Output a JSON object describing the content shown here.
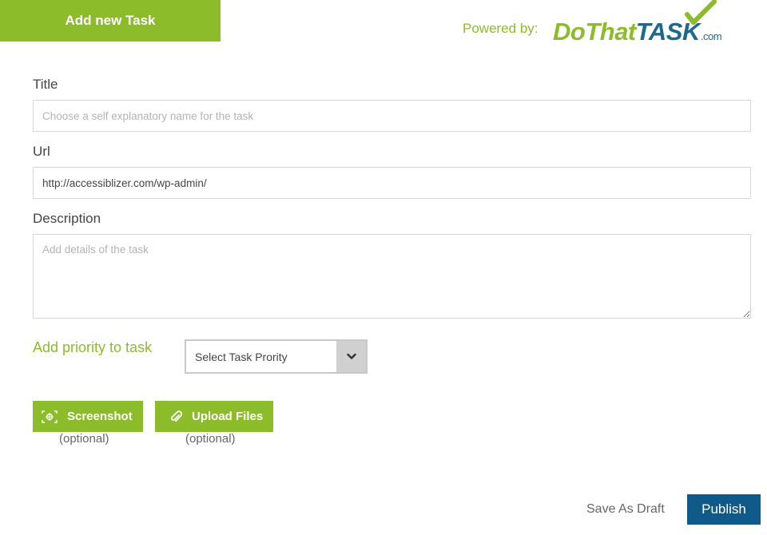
{
  "header": {
    "tab_label": "Add new Task",
    "powered_label": "Powered by:",
    "logo": {
      "do": "DoThat",
      "task": "TASK",
      "com": ".com"
    }
  },
  "form": {
    "title_label": "Title",
    "title_placeholder": "Choose a self explanatory name for the task",
    "title_value": "",
    "url_label": "Url",
    "url_value": "http://accessiblizer.com/wp-admin/",
    "description_label": "Description",
    "description_placeholder": "Add details of the task",
    "priority_label": "Add priority to task",
    "priority_select": "Select Task Prority"
  },
  "attachments": {
    "screenshot_label": "Screenshot",
    "screenshot_optional": "(optional)",
    "upload_label": "Upload Files",
    "upload_optional": "(optional)"
  },
  "actions": {
    "draft_label": "Save As Draft",
    "publish_label": "Publish"
  },
  "colors": {
    "brand_green": "#8cbc2a",
    "brand_blue": "#105a8a",
    "logo_blue": "#1b6a8e"
  },
  "icons": {
    "screenshot": "screenshot-icon",
    "upload": "paperclip-icon",
    "select": "chevron-down-icon",
    "logo_check": "checkmark-icon"
  }
}
